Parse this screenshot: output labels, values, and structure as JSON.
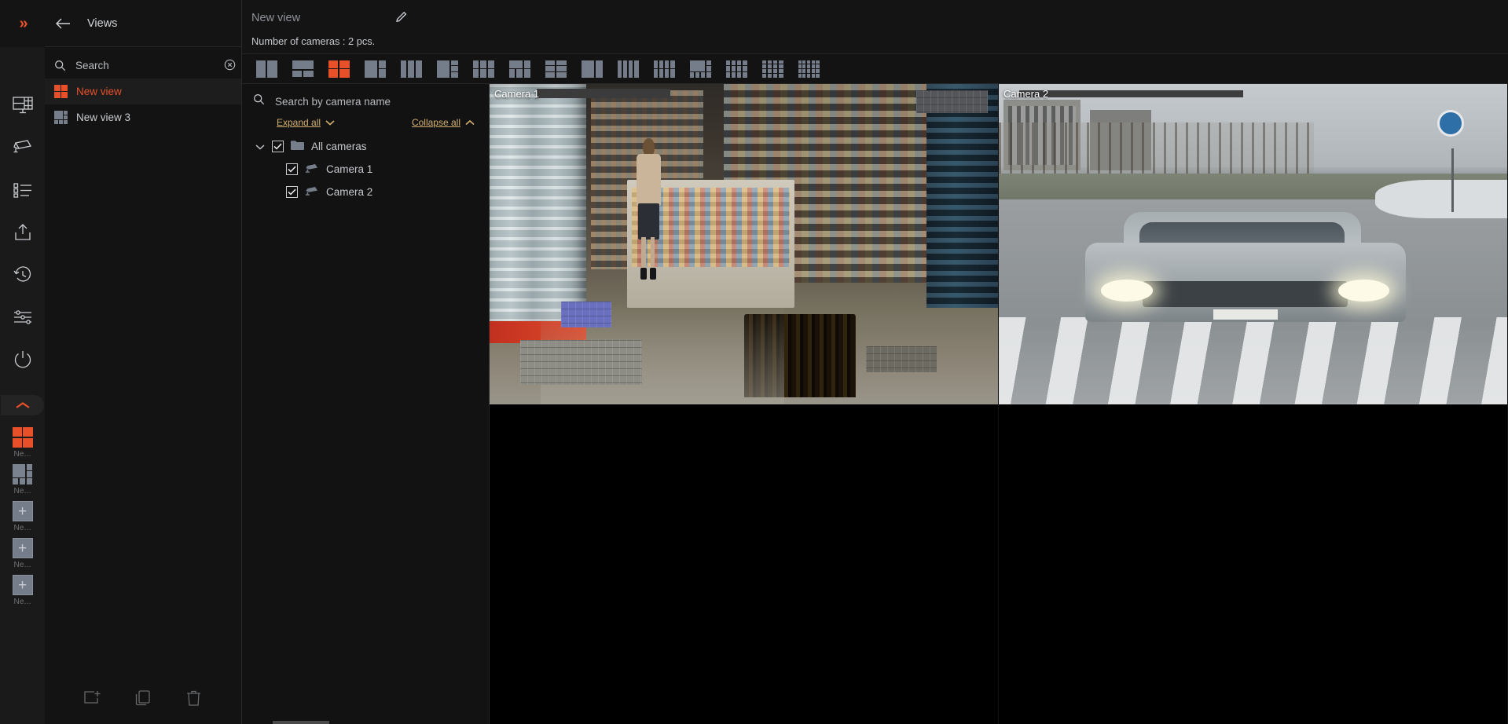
{
  "rail": {
    "expand_icon": "chevrons-right-icon",
    "icons": [
      {
        "name": "layouts-icon",
        "label": "Layouts"
      },
      {
        "name": "camera-icon",
        "label": "Cameras"
      },
      {
        "name": "events-list-icon",
        "label": "Events"
      },
      {
        "name": "export-icon",
        "label": "Export"
      },
      {
        "name": "history-icon",
        "label": "History"
      },
      {
        "name": "settings-sliders-icon",
        "label": "Settings"
      },
      {
        "name": "power-icon",
        "label": "Power"
      }
    ],
    "collapse_icon": "chevron-up-icon",
    "thumbnails": [
      {
        "label": "Ne...",
        "accent": true,
        "layout": "2x2"
      },
      {
        "label": "Ne...",
        "accent": false,
        "layout": "mixed"
      },
      {
        "label": "Ne...",
        "accent": false,
        "layout": "plus"
      },
      {
        "label": "Ne...",
        "accent": false,
        "layout": "plus"
      },
      {
        "label": "Ne...",
        "accent": false,
        "layout": "plus"
      }
    ]
  },
  "views_panel": {
    "back_icon": "back-arrow-icon",
    "title": "Views",
    "search": {
      "placeholder": "Search",
      "value": "",
      "icon": "search-icon",
      "clear_icon": "clear-circle-icon"
    },
    "items": [
      {
        "label": "New view",
        "active": true,
        "layout": "2x2"
      },
      {
        "label": "New view 3",
        "active": false,
        "layout": "mixed"
      }
    ],
    "footer_buttons": [
      {
        "name": "add-view-button",
        "icon": "add-view-icon"
      },
      {
        "name": "duplicate-view-button",
        "icon": "copy-icon"
      },
      {
        "name": "delete-view-button",
        "icon": "trash-icon"
      }
    ]
  },
  "main": {
    "view_title": "New view",
    "edit_icon": "pencil-icon",
    "camera_count_label": "Number of cameras : 2 pcs.",
    "layout_buttons": [
      {
        "name": "layout-1x2",
        "cols": 2,
        "rows": 1,
        "selected": false
      },
      {
        "name": "layout-1-over-2",
        "cols": 2,
        "rows": 2,
        "selected": false
      },
      {
        "name": "layout-2x2",
        "cols": 2,
        "rows": 2,
        "selected": true
      },
      {
        "name": "layout-1plus2",
        "cols": 3,
        "rows": 2,
        "selected": false
      },
      {
        "name": "layout-3col",
        "cols": 3,
        "rows": 1,
        "selected": false
      },
      {
        "name": "layout-1plus3",
        "cols": 3,
        "rows": 3,
        "selected": false
      },
      {
        "name": "layout-3x2",
        "cols": 3,
        "rows": 2,
        "selected": false
      },
      {
        "name": "layout-2plus2",
        "cols": 3,
        "rows": 2,
        "selected": false
      },
      {
        "name": "layout-2x3",
        "cols": 2,
        "rows": 3,
        "selected": false
      },
      {
        "name": "layout-big-left",
        "cols": 3,
        "rows": 2,
        "selected": false
      },
      {
        "name": "layout-4col",
        "cols": 4,
        "rows": 1,
        "selected": false
      },
      {
        "name": "layout-4x2",
        "cols": 4,
        "rows": 2,
        "selected": false
      },
      {
        "name": "layout-big-4",
        "cols": 4,
        "rows": 3,
        "selected": false
      },
      {
        "name": "layout-4x3",
        "cols": 4,
        "rows": 3,
        "selected": false
      },
      {
        "name": "layout-4x4",
        "cols": 4,
        "rows": 4,
        "selected": false
      },
      {
        "name": "layout-5x4",
        "cols": 5,
        "rows": 4,
        "selected": false
      }
    ]
  },
  "tree": {
    "search": {
      "placeholder": "Search by camera name",
      "value": "",
      "icon": "search-icon"
    },
    "expand_all_label": "Expand all",
    "collapse_all_label": "Collapse all",
    "expand_icon": "chevron-down-icon",
    "collapse_icon": "chevron-up-icon",
    "nodes": [
      {
        "label": "All cameras",
        "level": 0,
        "checked": true,
        "expanded": true,
        "icon": "folder-icon"
      },
      {
        "label": "Camera 1",
        "level": 1,
        "checked": true,
        "icon": "camera-icon"
      },
      {
        "label": "Camera 2",
        "level": 1,
        "checked": true,
        "icon": "camera-icon"
      }
    ]
  },
  "video": {
    "cells": [
      {
        "name": "video-cell-camera-1",
        "label": "Camera 1",
        "scene": "shop",
        "has_feed": true
      },
      {
        "name": "video-cell-camera-2",
        "label": "Camera 2",
        "scene": "street",
        "has_feed": true
      },
      {
        "name": "video-cell-empty-3",
        "label": "",
        "scene": "empty",
        "has_feed": false
      },
      {
        "name": "video-cell-empty-4",
        "label": "",
        "scene": "empty",
        "has_feed": false
      }
    ]
  },
  "colors": {
    "accent": "#e8502a",
    "panel_bg": "#131313",
    "rail_bg": "#1a1a1a",
    "text": "#c9ccd1",
    "link": "#d4b071"
  }
}
